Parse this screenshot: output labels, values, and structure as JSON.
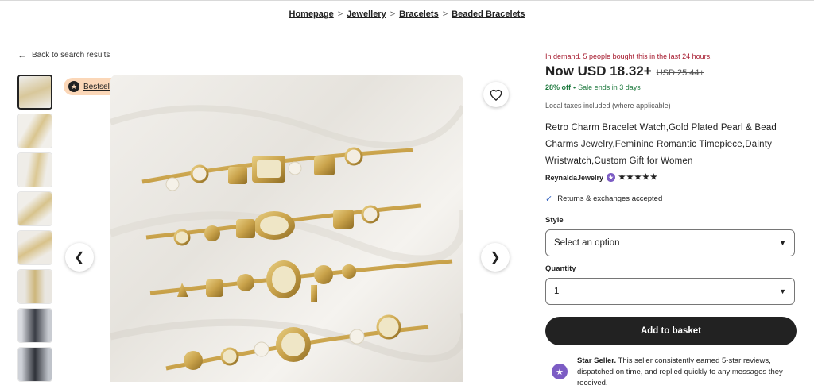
{
  "breadcrumb": [
    "Homepage",
    "Jewellery",
    "Bracelets",
    "Beaded Bracelets"
  ],
  "back_link": "Back to search results",
  "badge": {
    "label": "Bestseller",
    "icon": "bestseller-icon"
  },
  "gallery": {
    "thumbnail_count": 8,
    "active_index": 0,
    "colors": {
      "background": "#ece9e4",
      "gold": "#c9a24a",
      "pearl": "#f4f0e8",
      "dark": "#3a3a3a"
    }
  },
  "product": {
    "demand_text": "In demand. 5 people bought this in the last 24 hours.",
    "price_now": "Now USD 18.32+",
    "price_old": "USD 25.44+",
    "discount": "28% off",
    "sale_ends": "Sale ends in 3 days",
    "taxes": "Local taxes included (where applicable)",
    "title": "Retro Charm Bracelet Watch,Gold Plated Pearl & Bead Charms Jewelry,Feminine Romantic Timepiece,Dainty Wristwatch,Custom Gift for Women",
    "shop_name": "ReynaldaJewelry",
    "rating_stars": "★★★★★",
    "rating": 5,
    "returns": "Returns & exchanges accepted"
  },
  "options": {
    "style_label": "Style",
    "style_value": "Select an option",
    "quantity_label": "Quantity",
    "quantity_value": "1"
  },
  "add_to_basket": "Add to basket",
  "star_seller": {
    "title": "Star Seller.",
    "text": "This seller consistently earned 5-star reviews, dispatched on time, and replied quickly to any messages they received."
  },
  "colors": {
    "demand": "#a61a2e",
    "sale": "#1f7a3f",
    "badge_bg": "#fbd7b8",
    "star_seller": "#7c5cc4",
    "button": "#222222"
  }
}
